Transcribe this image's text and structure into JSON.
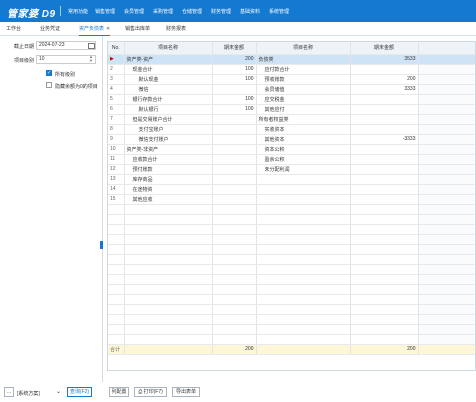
{
  "app": {
    "logo": "管家婆 D9",
    "menu": [
      "常用功能",
      "销售管理",
      "会员管理",
      "采购管理",
      "仓储管理",
      "财务管理",
      "基础资料",
      "系统管理"
    ]
  },
  "tabs": [
    {
      "label": "工作台"
    },
    {
      "label": "业务凭证"
    },
    {
      "label": "资产负债表",
      "active": true
    },
    {
      "label": "销售出库单"
    },
    {
      "label": "财务报表"
    }
  ],
  "filters": {
    "date_label": "截止日期",
    "date_value": "2024-07-23",
    "level_label": "项目级别",
    "level_value": "10",
    "show_all_label": "所有级别",
    "hide_zero_label": "隐藏余额为0的项目"
  },
  "grid": {
    "headers": [
      "No.",
      "项目名称",
      "期末金额",
      "项目名称",
      "期末金额"
    ],
    "rows": [
      {
        "no": "1",
        "name1": "资产类-资产",
        "amt1": "200",
        "name2": "负债类",
        "amt2": "3533",
        "level1": 0,
        "level2": 0
      },
      {
        "no": "2",
        "name1": "现金合计",
        "amt1": "100",
        "name2": "应付款合计",
        "amt2": "",
        "level1": 1,
        "level2": 1
      },
      {
        "no": "3",
        "name1": "默认现金",
        "amt1": "100",
        "name2": "预收账款",
        "amt2": "200",
        "level1": 2,
        "level2": 1
      },
      {
        "no": "4",
        "name1": "微信",
        "amt1": "",
        "name2": "会员储值",
        "amt2": "3333",
        "level1": 2,
        "level2": 1
      },
      {
        "no": "5",
        "name1": "银行存款合计",
        "amt1": "100",
        "name2": "应交税金",
        "amt2": "",
        "level1": 1,
        "level2": 1
      },
      {
        "no": "6",
        "name1": "默认银行",
        "amt1": "100",
        "name2": "其他应付",
        "amt2": "",
        "level1": 2,
        "level2": 1
      },
      {
        "no": "7",
        "name1": "但是交易账户合计",
        "amt1": "",
        "name2": "所有者权益类",
        "amt2": "",
        "level1": 1,
        "level2": 0
      },
      {
        "no": "8",
        "name1": "支付宝账户",
        "amt1": "",
        "name2": "实收资本",
        "amt2": "",
        "level1": 2,
        "level2": 1
      },
      {
        "no": "9",
        "name1": "微信支付账户",
        "amt1": "",
        "name2": "其他资本",
        "amt2": "-3333",
        "level1": 2,
        "level2": 1
      },
      {
        "no": "10",
        "name1": "资产类-非资产",
        "amt1": "",
        "name2": "资本公积",
        "amt2": "",
        "level1": 0,
        "level2": 1
      },
      {
        "no": "11",
        "name1": "应收款合计",
        "amt1": "",
        "name2": "盈余公积",
        "amt2": "",
        "level1": 1,
        "level2": 1
      },
      {
        "no": "12",
        "name1": "预付账款",
        "amt1": "",
        "name2": "未分配利润",
        "amt2": "",
        "level1": 1,
        "level2": 1
      },
      {
        "no": "13",
        "name1": "库存商品",
        "amt1": "",
        "name2": "",
        "amt2": "",
        "level1": 1,
        "level2": 1
      },
      {
        "no": "14",
        "name1": "在途物资",
        "amt1": "",
        "name2": "",
        "amt2": "",
        "level1": 1,
        "level2": 1
      },
      {
        "no": "15",
        "name1": "其他应收",
        "amt1": "",
        "name2": "",
        "amt2": "",
        "level1": 1,
        "level2": 1
      }
    ],
    "total": {
      "label": "合计",
      "amt1": "200",
      "amt2": "200"
    }
  },
  "bottom": {
    "scheme_label": "[系统方案]",
    "query_label": "查询(F2)",
    "columns_label": "列配置",
    "print_label": "打印(F7)",
    "export_label": "导出表单"
  }
}
